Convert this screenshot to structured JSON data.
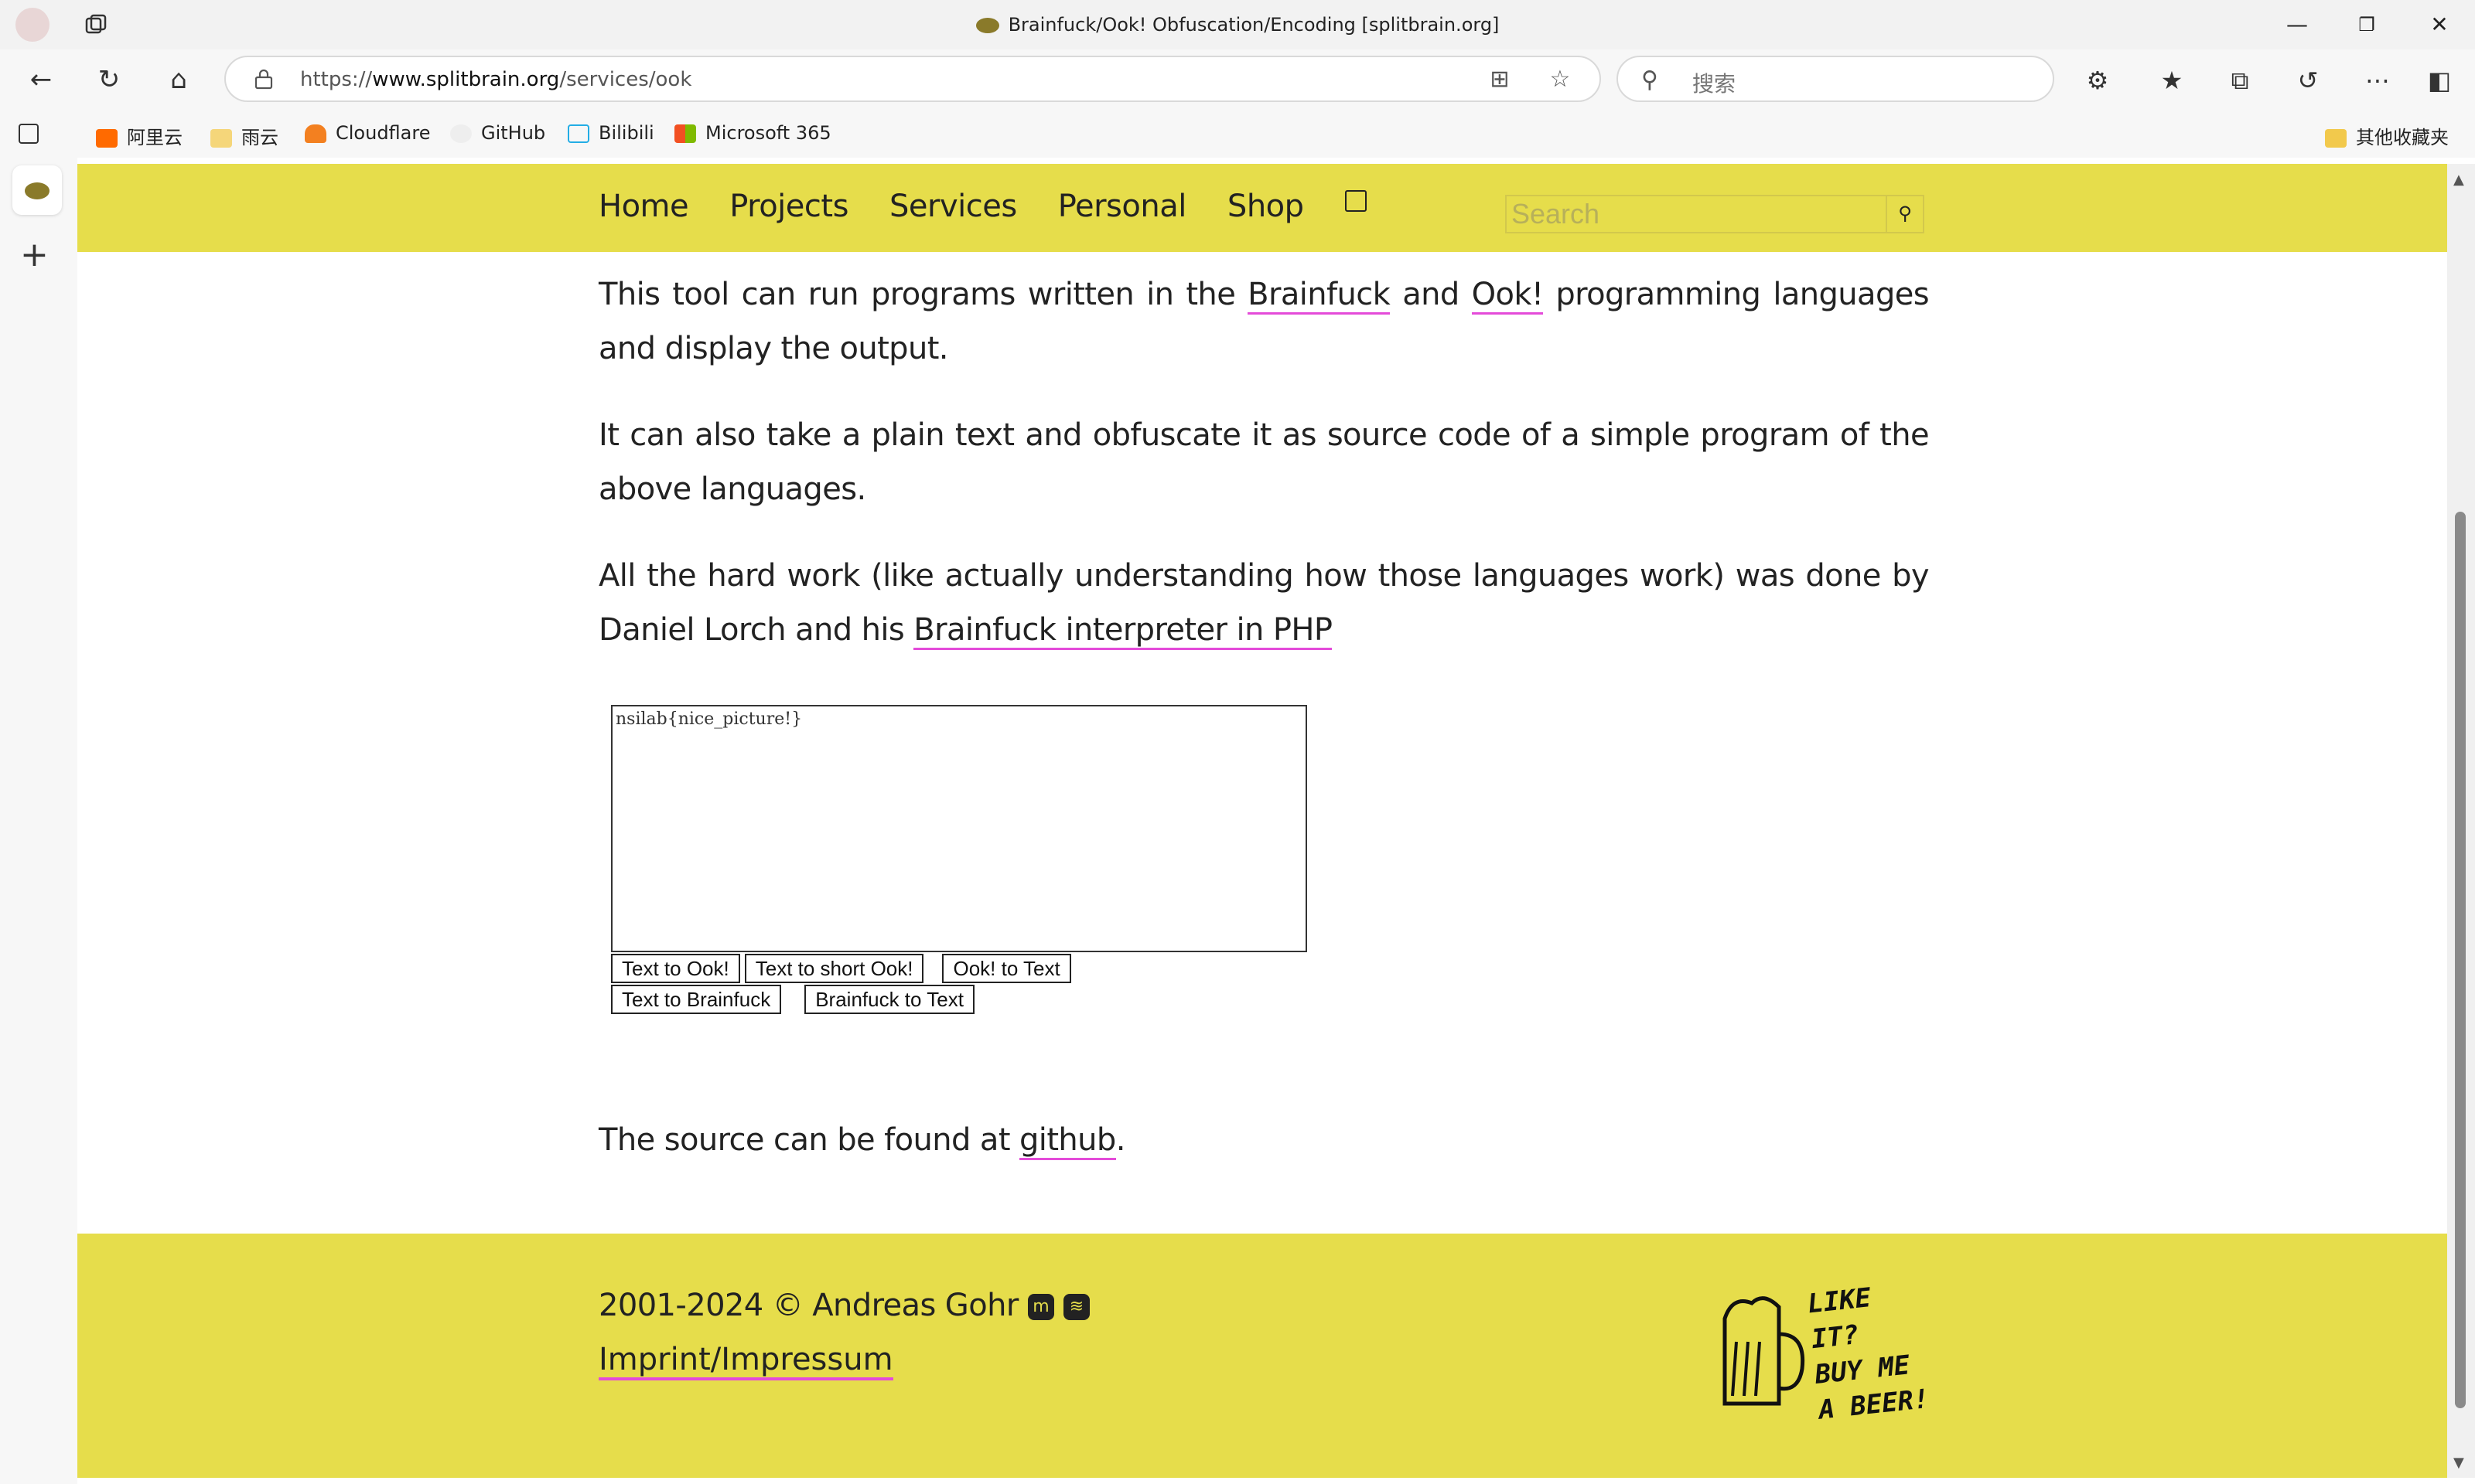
{
  "browser": {
    "title": "Brainfuck/Ook! Obfuscation/Encoding [splitbrain.org]",
    "url_prefix": "https://",
    "url_host": "www.splitbrain.org",
    "url_path": "/services/ook",
    "search_placeholder": "搜索",
    "bookmarks": [
      "阿里云",
      "雨云",
      "Cloudflare",
      "GitHub",
      "Bilibili",
      "Microsoft 365"
    ],
    "other_bookmarks": "其他收藏夹"
  },
  "site": {
    "nav": [
      "Home",
      "Projects",
      "Services",
      "Personal",
      "Shop"
    ],
    "search_placeholder": "Search"
  },
  "content": {
    "p1_a": "This tool can run programs written in the ",
    "p1_link1": "Brainfuck",
    "p1_b": " and ",
    "p1_link2": "Ook!",
    "p1_c": " programming languages and display the output.",
    "p2": "It can also take a plain text and obfuscate it as source code of a simple program of the above languages.",
    "p3_a": "All the hard work (like actually understanding how those languages work) was done by Daniel Lorch and his ",
    "p3_link": "Brainfuck interpreter in PHP",
    "textarea_value": "nsilab{nice_picture!}",
    "buttons_row1": [
      "Text to Ook!",
      "Text to short Ook!",
      "Ook! to Text"
    ],
    "buttons_row2": [
      "Text to Brainfuck",
      "Brainfuck to Text"
    ],
    "source_text": "The source can be found at ",
    "source_link": "github",
    "source_end": "."
  },
  "footer": {
    "copyright": "2001-2024 © Andreas Gohr",
    "imprint": "Imprint/Impressum",
    "beer_line1": "LIKE IT?",
    "beer_line2": "BUY ME",
    "beer_line3": "A BEER!"
  },
  "colors": {
    "header_bg": "#e6dd4b",
    "link_underline": "#e44bd9"
  }
}
